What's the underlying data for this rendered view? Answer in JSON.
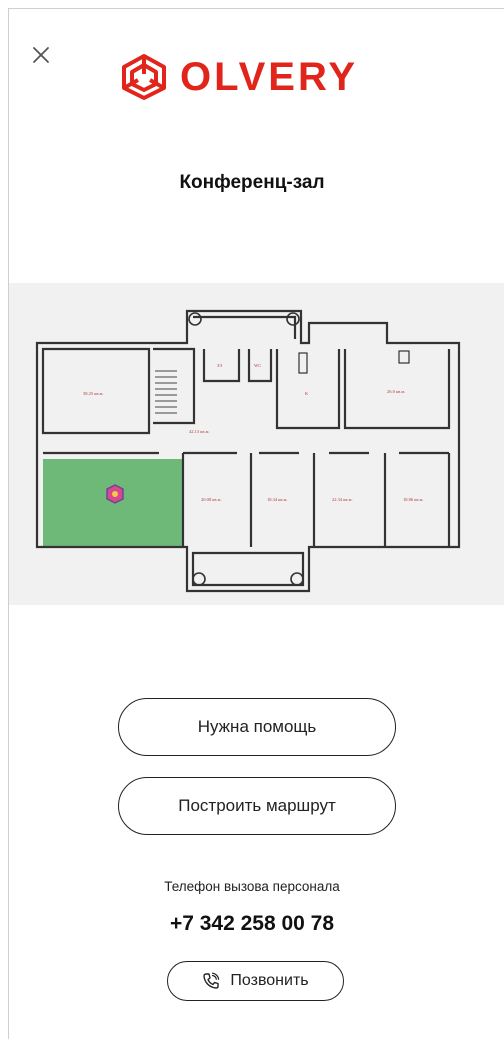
{
  "header": {
    "close_icon": "close-icon",
    "logo_text": "OLVERY",
    "brand_color": "#e1251b"
  },
  "room": {
    "title": "Конференц-зал",
    "highlight_color": "#5fb36a"
  },
  "floorplan": {
    "labels": {
      "room_top_left": "38.25 кв.м.",
      "wc_a": "ЗЭ",
      "wc_b": "WC",
      "kitchen": "К",
      "room_top_right": "26.0 кв.м.",
      "corridor": "42.13 кв.м.",
      "room_1": "20.08 кв.м.",
      "room_2": "18.34 кв.м.",
      "room_3": "22.34 кв.м.",
      "room_4": "18.86 кв.м."
    }
  },
  "actions": {
    "help_label": "Нужна помощь",
    "route_label": "Построить маршрут"
  },
  "contact": {
    "caption": "Телефон вызова персонала",
    "phone": "+7 342 258 00 78",
    "call_label": "Позвонить",
    "call_icon": "phone-icon"
  }
}
